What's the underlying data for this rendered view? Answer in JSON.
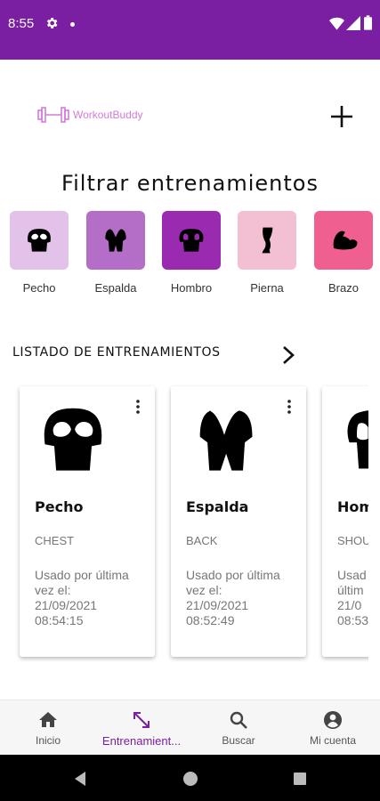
{
  "status_bar": {
    "time": "8:55",
    "color": "#7b1fa2"
  },
  "header": {
    "logo_text": "WorkoutBuddy",
    "add_icon": "plus-icon"
  },
  "filter": {
    "title": "Filtrar entrenamientos",
    "chips": [
      {
        "label": "Pecho",
        "color": "#e3c2ea",
        "icon": "chest-icon"
      },
      {
        "label": "Espalda",
        "color": "#b56ec7",
        "icon": "back-icon"
      },
      {
        "label": "Hombro",
        "color": "#9a2bb0",
        "icon": "shoulder-icon"
      },
      {
        "label": "Pierna",
        "color": "#f3bfd3",
        "icon": "leg-icon"
      },
      {
        "label": "Brazo",
        "color": "#ef5f8f",
        "icon": "arm-icon"
      }
    ]
  },
  "list": {
    "title": "LISTADO DE ENTRENAMIENTOS",
    "cards": [
      {
        "name": "Pecho",
        "english": "CHEST",
        "used_label": "Usado por última vez el:",
        "date": "21/09/2021 08:54:15"
      },
      {
        "name": "Espalda",
        "english": "BACK",
        "used_label": "Usado por última vez el:",
        "date": "21/09/2021 08:52:49"
      },
      {
        "name": "Hom",
        "english": "SHOU",
        "used_label": "Usad últim",
        "date": "21/0 08:53"
      }
    ]
  },
  "bottom_nav": {
    "items": [
      {
        "label": "Inicio",
        "icon": "home-icon"
      },
      {
        "label": "Entrenamient...",
        "icon": "arrows-expand-icon",
        "active": true
      },
      {
        "label": "Buscar",
        "icon": "search-icon"
      },
      {
        "label": "Mi cuenta",
        "icon": "account-icon"
      }
    ]
  }
}
